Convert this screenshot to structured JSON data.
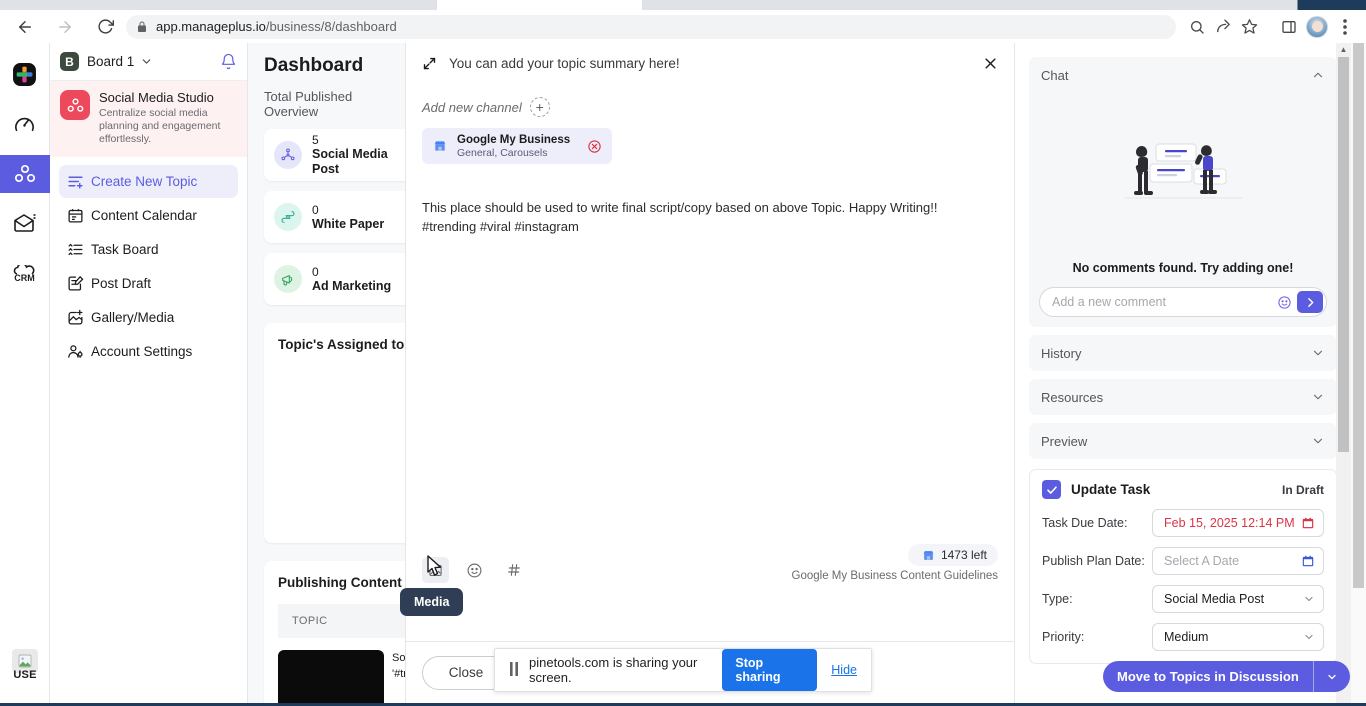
{
  "browser": {
    "back_icon": "back-arrow-icon",
    "forward_icon": "forward-arrow-icon",
    "reload_icon": "reload-icon",
    "lock_icon": "lock-icon",
    "url_host": "app.manageplus.io",
    "url_path": "/business/8/dashboard",
    "search_icon": "search-icon",
    "share_icon": "share-icon",
    "bookmark_icon": "star-icon",
    "sidepanel_icon": "side-panel-icon",
    "profile_icon": "profile-avatar",
    "menu_icon": "three-dot-menu-icon"
  },
  "rail": {
    "items": [
      {
        "name": "apps-grid-icon",
        "label": "Apps"
      },
      {
        "name": "speedometer-icon",
        "label": "Dashboard"
      },
      {
        "name": "social-studio-icon",
        "label": "Social Media Studio",
        "active": true
      },
      {
        "name": "mail-campaign-icon",
        "label": "Campaigns"
      },
      {
        "name": "crm-icon",
        "label": "CRM"
      }
    ],
    "bottom_label": "USE"
  },
  "sidebar": {
    "board_badge": "B",
    "board_name": "Board 1",
    "caret_icon": "chevron-down-icon",
    "bell_icon": "notification-bell-icon",
    "studio": {
      "title": "Social Media Studio",
      "subtitle": "Centralize social media planning and engagement effortlessly.",
      "logo_icon": "social-studio-logo"
    },
    "items": [
      {
        "label": "Create New Topic",
        "icon": "create-topic-icon",
        "active": true
      },
      {
        "label": "Content Calendar",
        "icon": "calendar-icon",
        "active": false
      },
      {
        "label": "Task Board",
        "icon": "task-list-icon",
        "active": false
      },
      {
        "label": "Post Draft",
        "icon": "draft-edit-icon",
        "active": false
      },
      {
        "label": "Gallery/Media",
        "icon": "gallery-add-icon",
        "active": false
      },
      {
        "label": "Account Settings",
        "icon": "account-settings-icon",
        "active": false
      }
    ]
  },
  "dashboard": {
    "title": "Dashboard",
    "subtitle": "Total Published Overview",
    "stats": [
      {
        "count": "5",
        "label": "Social Media Post",
        "icon": "share-nodes-icon",
        "bg": "#e6e6fa",
        "fg": "#6b5ce0"
      },
      {
        "count": "0",
        "label": "White Paper",
        "icon": "paper-pen-icon",
        "bg": "#dcf5ef",
        "fg": "#2fa98c"
      },
      {
        "count": "0",
        "label": "Ad Marketing",
        "icon": "megaphone-hand-icon",
        "bg": "#ddf3e4",
        "fg": "#35a05c"
      }
    ],
    "assigned_title": "Topic's Assigned to me",
    "publishing_title": "Publishing Content",
    "publishing_col_header": "TOPIC",
    "publishing_row_line1": "Soc",
    "publishing_row_line2": "'#tr"
  },
  "modal": {
    "expand_icon": "expand-diagonal-icon",
    "summary_placeholder": "You can add your topic summary here!",
    "close_icon": "close-x-icon",
    "add_channel_label": "Add new channel",
    "add_channel_plus": "+",
    "channel": {
      "icon": "google-my-business-icon",
      "name": "Google My Business",
      "categories": "General, Carousels",
      "remove_icon": "remove-circle-icon"
    },
    "editor_line1": "This place should be used to write final script/copy based on above Topic. Happy Writing!!",
    "editor_line2": "#trending #viral #instagram",
    "toolbar": {
      "media_icon": "media-image-icon",
      "emoji_icon": "emoji-smiley-icon",
      "hashtag_icon": "hashtag-icon",
      "tooltip": "Media"
    },
    "char_counter": "1473 left",
    "char_counter_icon": "google-my-business-icon",
    "guidelines": "Google My Business Content Guidelines",
    "close_button": "Close"
  },
  "right_panel": {
    "chat": {
      "title": "Chat",
      "chevron": "chevron-up-icon",
      "empty_text": "No comments found. Try adding one!",
      "input_placeholder": "Add a new comment",
      "emoji_icon": "emoji-smiley-icon",
      "send_icon": "send-arrow-icon"
    },
    "sections": [
      {
        "title": "History",
        "chevron": "chevron-down-icon"
      },
      {
        "title": "Resources",
        "chevron": "chevron-down-icon"
      },
      {
        "title": "Preview",
        "chevron": "chevron-down-icon"
      }
    ],
    "task": {
      "title": "Update Task",
      "status": "In Draft",
      "checkbox_icon": "checkmark-icon",
      "fields": [
        {
          "label": "Task Due Date:",
          "value": "Feb 15, 2025 12:14 PM",
          "state": "danger",
          "icon": "calendar-red-icon"
        },
        {
          "label": "Publish Plan Date:",
          "value": "Select A Date",
          "state": "muted",
          "icon": "calendar-blue-icon"
        },
        {
          "label": "Type:",
          "value": "Social Media Post",
          "state": "normal",
          "icon": "chevron-down-icon"
        },
        {
          "label": "Priority:",
          "value": "Medium",
          "state": "normal",
          "icon": "chevron-down-icon"
        }
      ]
    }
  },
  "footer": {
    "move_button": "Move to Topics in Discussion",
    "move_button_caret": "chevron-down-icon"
  },
  "share_bar": {
    "pause_icon": "pause-bars-icon",
    "message": "pinetools.com is sharing your screen.",
    "stop_label": "Stop sharing",
    "hide_label": "Hide"
  },
  "colors": {
    "accent": "#5c5ce0",
    "danger": "#d93447",
    "chrome_blue": "#1a73e8",
    "studio_red": "#ec4a5c"
  }
}
